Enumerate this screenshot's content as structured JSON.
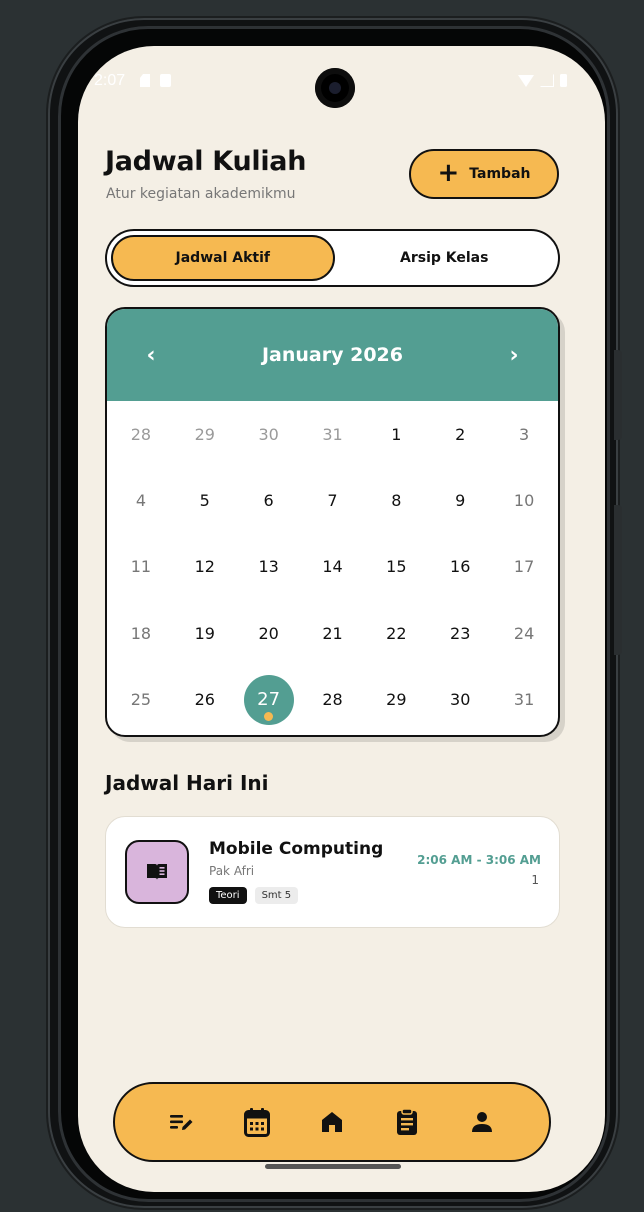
{
  "status_bar": {
    "time": "2:07"
  },
  "header": {
    "title": "Jadwal Kuliah",
    "subtitle": "Atur kegiatan akademikmu",
    "add_button_label": "Tambah"
  },
  "tabs": [
    {
      "label": "Jadwal Aktif",
      "active": true
    },
    {
      "label": "Arsip Kelas",
      "active": false
    }
  ],
  "calendar": {
    "month_label": "January 2026",
    "prev_symbol": "‹",
    "next_symbol": "›",
    "selected_day": "27",
    "weeks": [
      [
        {
          "d": "28",
          "muted": true
        },
        {
          "d": "29",
          "muted": true
        },
        {
          "d": "30",
          "muted": true
        },
        {
          "d": "31",
          "muted": true
        },
        {
          "d": "1"
        },
        {
          "d": "2"
        },
        {
          "d": "3",
          "weekend": true
        }
      ],
      [
        {
          "d": "4",
          "weekend": true
        },
        {
          "d": "5"
        },
        {
          "d": "6"
        },
        {
          "d": "7"
        },
        {
          "d": "8"
        },
        {
          "d": "9"
        },
        {
          "d": "10",
          "weekend": true
        }
      ],
      [
        {
          "d": "11",
          "weekend": true
        },
        {
          "d": "12"
        },
        {
          "d": "13"
        },
        {
          "d": "14"
        },
        {
          "d": "15"
        },
        {
          "d": "16"
        },
        {
          "d": "17",
          "weekend": true
        }
      ],
      [
        {
          "d": "18",
          "weekend": true
        },
        {
          "d": "19"
        },
        {
          "d": "20"
        },
        {
          "d": "21"
        },
        {
          "d": "22"
        },
        {
          "d": "23"
        },
        {
          "d": "24",
          "weekend": true
        }
      ],
      [
        {
          "d": "25",
          "weekend": true
        },
        {
          "d": "26"
        },
        {
          "d": "27",
          "selected": true,
          "event": true
        },
        {
          "d": "28"
        },
        {
          "d": "29"
        },
        {
          "d": "30"
        },
        {
          "d": "31",
          "weekend": true
        }
      ]
    ]
  },
  "today": {
    "section_title": "Jadwal Hari Ini",
    "classes": [
      {
        "course": "Mobile Computing",
        "lecturer": "Pak Afri",
        "type_tag": "Teori",
        "semester_tag": "Smt 5",
        "time": "2:06 AM - 3:06 AM",
        "room": "1",
        "icon": "book-icon"
      }
    ]
  },
  "bottom_nav": [
    {
      "icon": "edit-list-icon"
    },
    {
      "icon": "calendar-icon",
      "active": true
    },
    {
      "icon": "home-icon"
    },
    {
      "icon": "clipboard-icon"
    },
    {
      "icon": "person-icon"
    }
  ],
  "colors": {
    "background": "#f4efe5",
    "accent_yellow": "#f6b951",
    "accent_teal": "#539e92",
    "icon_box_purple": "#d9b5dc"
  }
}
